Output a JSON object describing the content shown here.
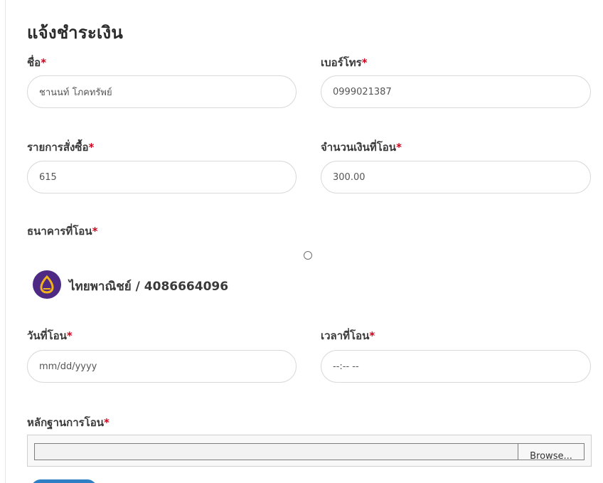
{
  "form": {
    "title": "แจ้งชำระเงิน",
    "required_mark": "*",
    "name": {
      "label": "ชื่อ",
      "value": "ชานนท์ โภคทรัพย์"
    },
    "phone": {
      "label": "เบอร์โทร",
      "value": "0999021387"
    },
    "order": {
      "label": "รายการสั่งซื้อ",
      "value": "615"
    },
    "amount": {
      "label": "จำนวนเงินที่โอน",
      "value": "300.00"
    },
    "bank": {
      "label": "ธนาคารที่โอน",
      "options": [
        {
          "name": "ไทยพาณิชย์ / 4086664096",
          "selected": false,
          "logo_icon": "scb-bank-logo-icon",
          "logo_color": "#4e2a84",
          "logo_accent": "#f2b31a"
        }
      ]
    },
    "date": {
      "label": "วันที่โอน",
      "placeholder": "mm/dd/yyyy"
    },
    "time": {
      "label": "เวลาที่โอน",
      "placeholder": "--:-- --"
    },
    "proof": {
      "label": "หลักฐานการโอน",
      "browse_label": "Browse..."
    },
    "submit_label": ""
  },
  "colors": {
    "required": "#d0021b",
    "border": "#d9d9d9",
    "submit_button": "#2f7fc4"
  }
}
